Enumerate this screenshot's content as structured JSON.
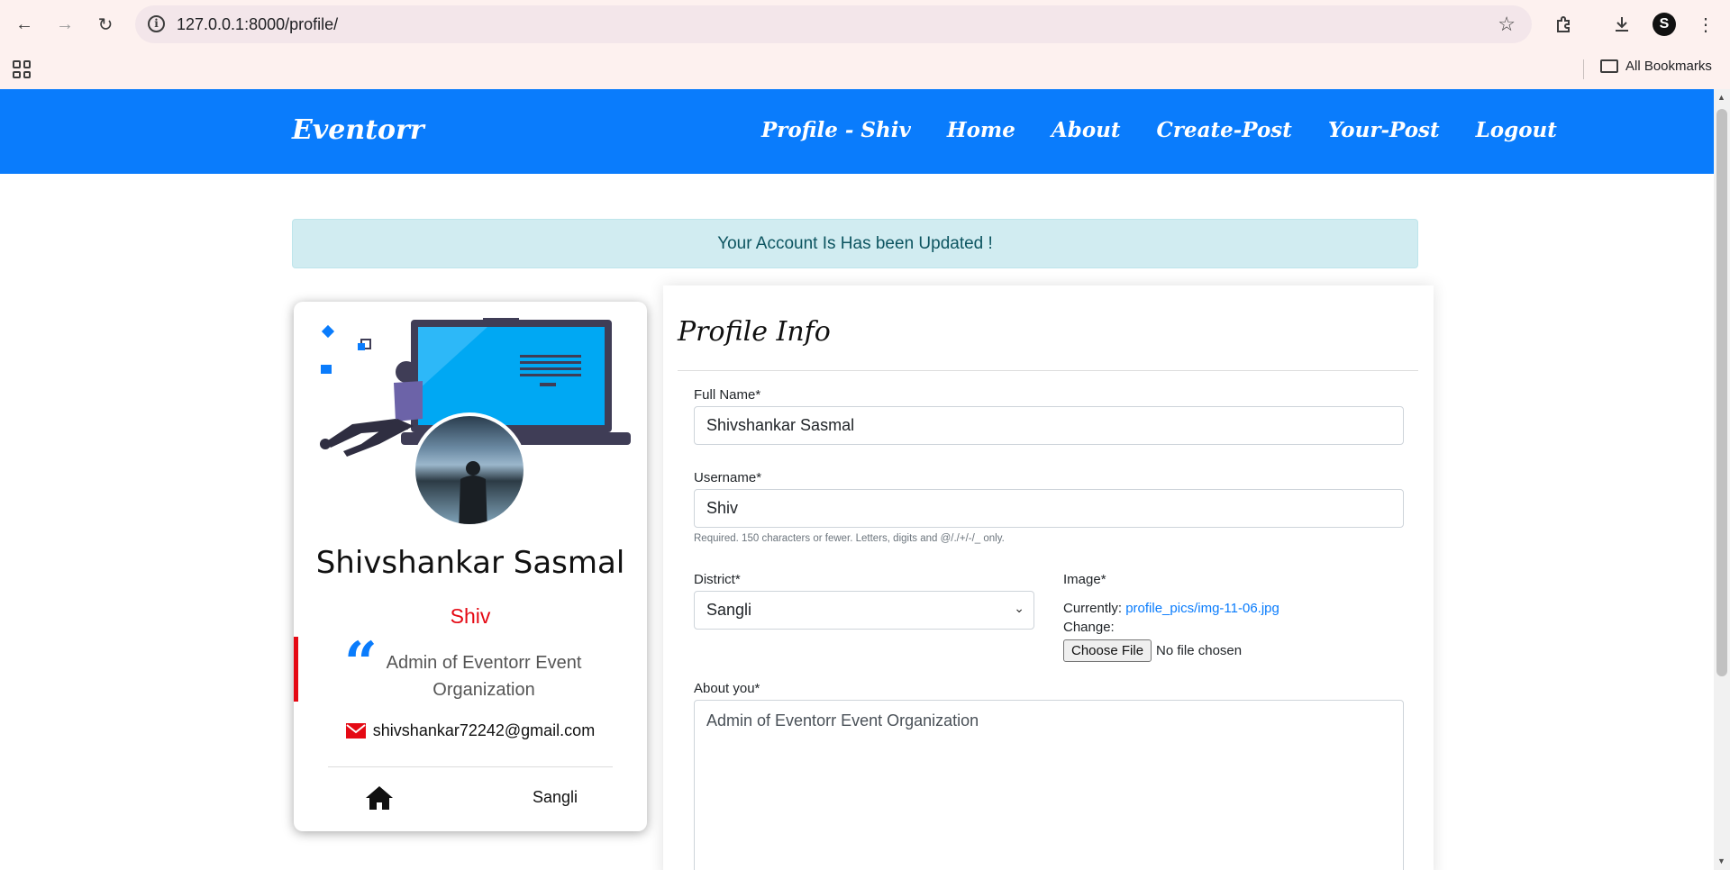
{
  "browser": {
    "url": "127.0.0.1:8000/profile/",
    "profile_initial": "S",
    "bookmarks_label": "All Bookmarks"
  },
  "navbar": {
    "brand": "Eventorr",
    "links": [
      "Profile - Shiv",
      "Home",
      "About",
      "Create-Post",
      "Your-Post",
      "Logout"
    ]
  },
  "alert": {
    "message": "Your Account Is Has been Updated !"
  },
  "card": {
    "full_name": "Shivshankar Sasmal",
    "username": "Shiv",
    "about": "Admin of Eventorr Event Organization",
    "email": "shivshankar72242@gmail.com",
    "district": "Sangli"
  },
  "form": {
    "title": "Profile Info",
    "full_name_label": "Full Name*",
    "full_name_value": "Shivshankar Sasmal",
    "username_label": "Username*",
    "username_value": "Shiv",
    "username_help": "Required. 150 characters or fewer. Letters, digits and @/./+/-/_ only.",
    "district_label": "District*",
    "district_value": "Sangli",
    "image_label": "Image*",
    "currently_label": "Currently:",
    "current_image": "profile_pics/img-11-06.jpg",
    "change_label": "Change:",
    "choose_file_label": "Choose File",
    "no_file_text": "No file chosen",
    "about_label": "About you*",
    "about_value": "Admin of Eventorr Event Organization"
  },
  "colors": {
    "primary": "#0a7cfc",
    "accent_red": "#e50914",
    "alert_bg": "#d1ecf1",
    "alert_text": "#0c5460"
  }
}
